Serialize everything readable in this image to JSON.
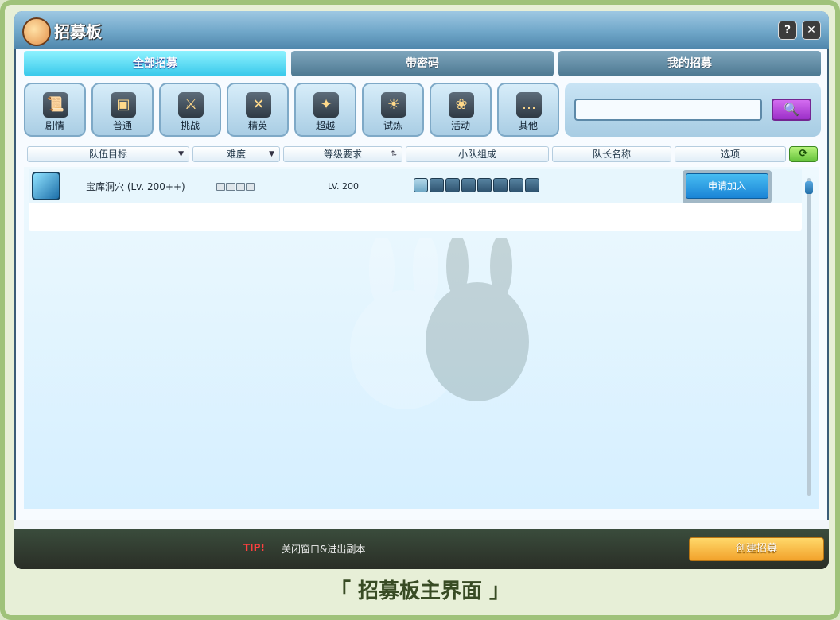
{
  "window": {
    "title": "招募板"
  },
  "titlebar": {
    "help": "?",
    "close": "✕"
  },
  "tabs": [
    {
      "label": "全部招募",
      "active": true
    },
    {
      "label": "带密码",
      "active": false
    },
    {
      "label": "我的招募",
      "active": false
    }
  ],
  "categories": [
    {
      "label": "剧情",
      "icon": "scroll-icon"
    },
    {
      "label": "普通",
      "icon": "chest-icon"
    },
    {
      "label": "挑战",
      "icon": "sword-icon"
    },
    {
      "label": "精英",
      "icon": "crossed-swords-icon"
    },
    {
      "label": "超越",
      "icon": "fire-figure-icon"
    },
    {
      "label": "试炼",
      "icon": "sunrise-icon"
    },
    {
      "label": "活动",
      "icon": "bouquet-icon"
    },
    {
      "label": "其他",
      "icon": "chat-bubble-icon"
    }
  ],
  "search": {
    "placeholder": "",
    "button": "🔍"
  },
  "list_header": {
    "target": "队伍目标",
    "difficulty": "难度",
    "level": "等级要求",
    "team": "小队组成",
    "leader": "队长名称",
    "options": "选项",
    "refresh": "⟳"
  },
  "rows": [
    {
      "target": "宝库洞穴 (Lv. 200++)",
      "difficulty_level": 0,
      "difficulty_max": 4,
      "level": "LV. 200",
      "team_slots": 8,
      "team_filled": 1,
      "leader": "",
      "action": "申请加入"
    }
  ],
  "bottom": {
    "tip_label": "TIP!",
    "tip_text": "关闭窗口&进出副本",
    "create_button": "创建招募"
  },
  "caption": "「 招募板主界面 」",
  "colors": {
    "accent": "#37c8ea",
    "create": "#f2a22b",
    "search": "#9b2fc8"
  }
}
